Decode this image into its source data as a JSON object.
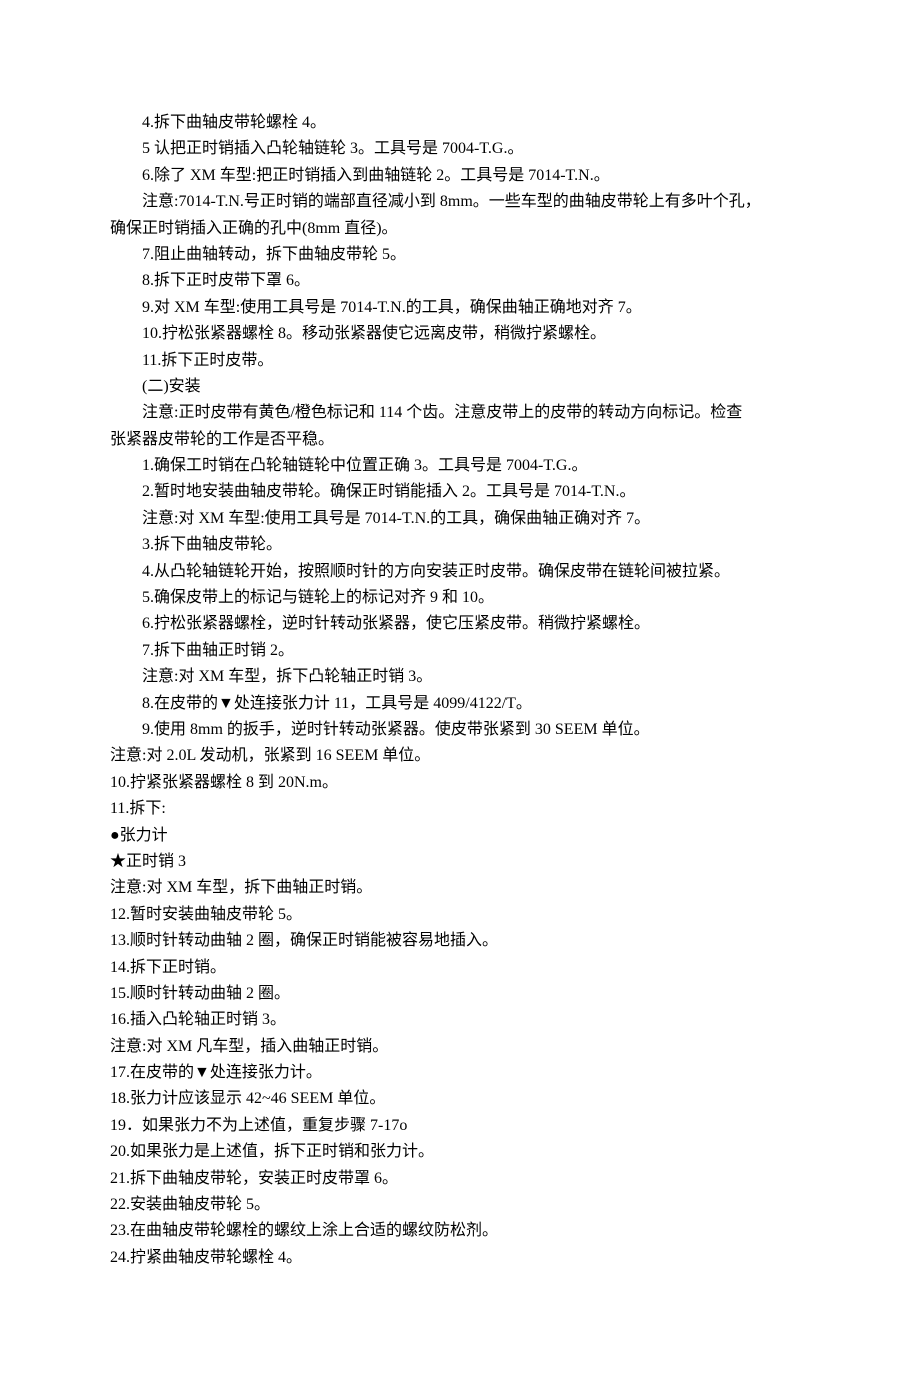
{
  "lines": [
    {
      "cls": "indent",
      "text": "4.拆下曲轴皮带轮螺栓 4。"
    },
    {
      "cls": "indent",
      "text": "5 认把正时销插入凸轮轴链轮 3。工具号是 7004-T.G.。"
    },
    {
      "cls": "indent",
      "text": "6.除了 XM 车型:把正时销插入到曲轴链轮 2。工具号是 7014-T.N.。"
    },
    {
      "cls": "indent",
      "text": "注意:7014-T.N.号正时销的端部直径减小到 8mm。一些车型的曲轴皮带轮上有多叶个孔，"
    },
    {
      "cls": "no-indent",
      "text": "确保正时销插入正确的孔中(8mm 直径)。"
    },
    {
      "cls": "indent",
      "text": "7.阻止曲轴转动，拆下曲轴皮带轮 5。"
    },
    {
      "cls": "indent",
      "text": "8.拆下正时皮带下罩 6。"
    },
    {
      "cls": "indent",
      "text": "9.对 XM 车型:使用工具号是 7014-T.N.的工具，确保曲轴正确地对齐 7。"
    },
    {
      "cls": "indent",
      "text": "10.拧松张紧器螺栓 8。移动张紧器使它远离皮带，稍微拧紧螺栓。"
    },
    {
      "cls": "indent",
      "text": "11.拆下正时皮带。"
    },
    {
      "cls": "indent",
      "text": "(二)安装"
    },
    {
      "cls": "indent",
      "text": "注意:正时皮带有黄色/橙色标记和 114 个齿。注意皮带上的皮带的转动方向标记。检查"
    },
    {
      "cls": "no-indent",
      "text": "张紧器皮带轮的工作是否平稳。"
    },
    {
      "cls": "indent",
      "text": "1.确保工时销在凸轮轴链轮中位置正确 3。工具号是 7004-T.G.。"
    },
    {
      "cls": "indent",
      "text": "2.暂时地安装曲轴皮带轮。确保正时销能插入 2。工具号是 7014-T.N.。"
    },
    {
      "cls": "indent",
      "text": "注意:对 XM 车型:使用工具号是 7014-T.N.的工具，确保曲轴正确对齐 7。"
    },
    {
      "cls": "indent",
      "text": "3.拆下曲轴皮带轮。"
    },
    {
      "cls": "indent",
      "text": "4.从凸轮轴链轮开始，按照顺时针的方向安装正时皮带。确保皮带在链轮间被拉紧。"
    },
    {
      "cls": "indent",
      "text": "5.确保皮带上的标记与链轮上的标记对齐 9 和 10。"
    },
    {
      "cls": "indent",
      "text": "6.拧松张紧器螺栓，逆时针转动张紧器，使它压紧皮带。稍微拧紧螺栓。"
    },
    {
      "cls": "indent",
      "text": "7.拆下曲轴正时销 2。"
    },
    {
      "cls": "indent",
      "text": "注意:对 XM 车型，拆下凸轮轴正时销 3。"
    },
    {
      "cls": "indent",
      "text": "8.在皮带的▼处连接张力计 11，工具号是 4099/4122/T。"
    },
    {
      "cls": "indent",
      "text": "9.使用 8mm 的扳手，逆时针转动张紧器。使皮带张紧到 30 SEEM 单位。"
    },
    {
      "cls": "no-indent",
      "text": "注意:对 2.0L 发动机，张紧到 16 SEEM 单位。"
    },
    {
      "cls": "no-indent",
      "text": "10.拧紧张紧器螺栓 8 到 20N.m。"
    },
    {
      "cls": "no-indent",
      "text": "11.拆下:"
    },
    {
      "cls": "no-indent",
      "text": "●张力计"
    },
    {
      "cls": "no-indent",
      "text": "★正时销 3"
    },
    {
      "cls": "no-indent",
      "text": "注意:对 XM 车型，拆下曲轴正时销。"
    },
    {
      "cls": "no-indent",
      "text": "12.暂时安装曲轴皮带轮 5。"
    },
    {
      "cls": "no-indent",
      "text": "13.顺时针转动曲轴 2 圈，确保正时销能被容易地插入。"
    },
    {
      "cls": "no-indent",
      "text": "14.拆下正时销。"
    },
    {
      "cls": "no-indent",
      "text": "15.顺时针转动曲轴 2 圈。"
    },
    {
      "cls": "no-indent",
      "text": "16.插入凸轮轴正时销 3。"
    },
    {
      "cls": "no-indent",
      "text": "注意:对 XM 凡车型，插入曲轴正时销。"
    },
    {
      "cls": "no-indent",
      "text": "17.在皮带的▼处连接张力计。"
    },
    {
      "cls": "no-indent",
      "text": "18.张力计应该显示 42~46 SEEM 单位。"
    },
    {
      "cls": "no-indent",
      "text": "19．如果张力不为上述值，重复步骤 7-17o"
    },
    {
      "cls": "no-indent",
      "text": "20.如果张力是上述值，拆下正时销和张力计。"
    },
    {
      "cls": "no-indent",
      "text": "21.拆下曲轴皮带轮，安装正时皮带罩 6。"
    },
    {
      "cls": "no-indent",
      "text": "22.安装曲轴皮带轮 5。"
    },
    {
      "cls": "no-indent",
      "text": "23.在曲轴皮带轮螺栓的螺纹上涂上合适的螺纹防松剂。"
    },
    {
      "cls": "no-indent",
      "text": "24.拧紧曲轴皮带轮螺栓 4。"
    }
  ]
}
